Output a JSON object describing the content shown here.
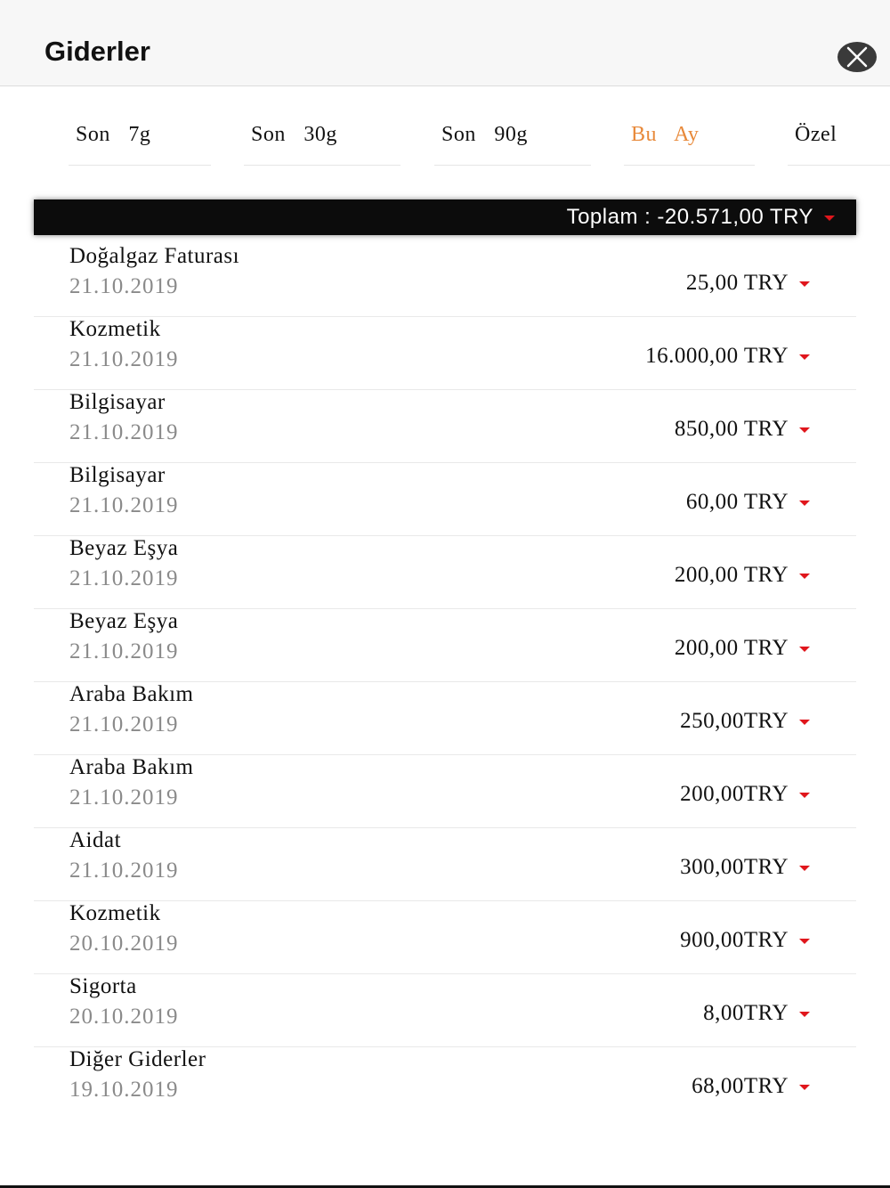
{
  "header": {
    "title": "Giderler",
    "close_icon": "close-icon"
  },
  "tabs": [
    {
      "label": "Son 7g",
      "active": false
    },
    {
      "label": "Son 30g",
      "active": false
    },
    {
      "label": "Son 90g",
      "active": false
    },
    {
      "label": "Bu Ay",
      "active": true
    },
    {
      "label": "Özel",
      "active": false
    }
  ],
  "total": {
    "text": "Toplam : -20.571,00 TRY",
    "indicator_icon": "caret-down-icon"
  },
  "expenses": [
    {
      "name": "Doğalgaz Faturası",
      "date": "21.10.2019",
      "amount": "25,00 TRY"
    },
    {
      "name": "Kozmetik",
      "date": "21.10.2019",
      "amount": "16.000,00 TRY"
    },
    {
      "name": "Bilgisayar",
      "date": "21.10.2019",
      "amount": "850,00 TRY"
    },
    {
      "name": "Bilgisayar",
      "date": "21.10.2019",
      "amount": "60,00 TRY"
    },
    {
      "name": "Beyaz Eşya",
      "date": "21.10.2019",
      "amount": "200,00 TRY"
    },
    {
      "name": "Beyaz Eşya",
      "date": "21.10.2019",
      "amount": "200,00 TRY"
    },
    {
      "name": "Araba Bakım",
      "date": "21.10.2019",
      "amount": "250,00TRY"
    },
    {
      "name": "Araba Bakım",
      "date": "21.10.2019",
      "amount": "200,00TRY"
    },
    {
      "name": "Aidat",
      "date": "21.10.2019",
      "amount": "300,00TRY"
    },
    {
      "name": "Kozmetik",
      "date": "20.10.2019",
      "amount": "900,00TRY"
    },
    {
      "name": "Sigorta",
      "date": "20.10.2019",
      "amount": "8,00TRY"
    },
    {
      "name": "Diğer Giderler",
      "date": "19.10.2019",
      "amount": "68,00TRY"
    }
  ],
  "colors": {
    "accent_active_tab": "#e8893a",
    "negative_indicator": "#e0161c",
    "total_bar_bg": "#0c0c0c",
    "date_text": "#8a8a8a"
  }
}
